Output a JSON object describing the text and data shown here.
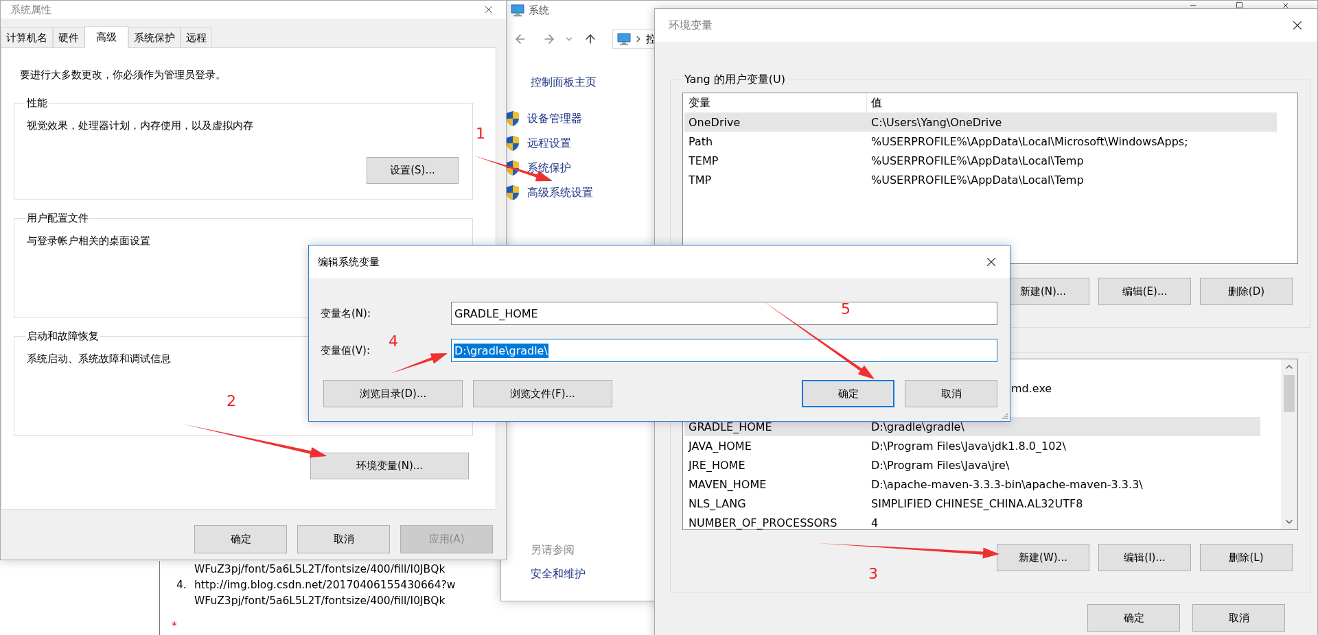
{
  "system_properties": {
    "title": "系统属性",
    "tabs": [
      {
        "label": "计算机名",
        "selected": false
      },
      {
        "label": "硬件",
        "selected": false
      },
      {
        "label": "高级",
        "selected": true
      },
      {
        "label": "系统保护",
        "selected": false
      },
      {
        "label": "远程",
        "selected": false
      }
    ],
    "notice": "要进行大多数更改，你必须作为管理员登录。",
    "groups": [
      {
        "title": "性能",
        "description": "视觉效果，处理器计划，内存使用，以及虚拟内存",
        "button": "设置(S)..."
      },
      {
        "title": "用户配置文件",
        "description": "与登录帐户相关的桌面设置"
      },
      {
        "title": "启动和故障恢复",
        "description": "系统启动、系统故障和调试信息"
      }
    ],
    "env_button": "环境变量(N)...",
    "buttons": [
      {
        "label": "确定",
        "disabled": false
      },
      {
        "label": "取消",
        "disabled": false
      },
      {
        "label": "应用(A)",
        "disabled": true
      }
    ]
  },
  "control_panel": {
    "title": "系统",
    "address": "控",
    "home_link": "控制面板主页",
    "links": [
      "设备管理器",
      "远程设置",
      "系统保护",
      "高级系统设置"
    ],
    "see_also": {
      "heading": "另请参阅",
      "links": [
        "安全和维护"
      ]
    }
  },
  "blog_page": {
    "lines": [
      {
        "text": "WFuZ3pj/font/5a6L5L2T/fontsize/400/fill/I0JBQk"
      },
      {
        "number": "4.",
        "text": "http://img.blog.csdn.net/20170406155430664?w"
      },
      {
        "text": "WFuZ3pj/font/5a6L5L2T/fontsize/400/fill/I0JBQk"
      }
    ],
    "required_mark": "*"
  },
  "environment_variables": {
    "title": "环境变量",
    "user_variables": {
      "title": "Yang 的用户变量(U)",
      "columns": [
        "变量",
        "值"
      ],
      "rows": [
        {
          "name": "OneDrive",
          "value": "C:\\Users\\Yang\\OneDrive",
          "selected": true
        },
        {
          "name": "Path",
          "value": "%USERPROFILE%\\AppData\\Local\\Microsoft\\WindowsApps;",
          "selected": false
        },
        {
          "name": "TEMP",
          "value": "%USERPROFILE%\\AppData\\Local\\Temp",
          "selected": false
        },
        {
          "name": "TMP",
          "value": "%USERPROFILE%\\AppData\\Local\\Temp",
          "selected": false
        }
      ],
      "buttons": [
        "新建(N)...",
        "编辑(E)...",
        "删除(D)"
      ]
    },
    "system_variables": {
      "rows": [
        {
          "value": "md.exe",
          "selected": false
        },
        {
          "name": "GRADLE_HOME",
          "value": "D:\\gradle\\gradle\\",
          "selected": true
        },
        {
          "name": "JAVA_HOME",
          "value": "D:\\Program Files\\Java\\jdk1.8.0_102\\",
          "selected": false
        },
        {
          "name": "JRE_HOME",
          "value": "D:\\Program Files\\Java\\jre\\",
          "selected": false
        },
        {
          "name": "MAVEN_HOME",
          "value": "D:\\apache-maven-3.3.3-bin\\apache-maven-3.3.3\\",
          "selected": false
        },
        {
          "name": "NLS_LANG",
          "value": "SIMPLIFIED CHINESE_CHINA.AL32UTF8",
          "selected": false
        },
        {
          "name": "NUMBER_OF_PROCESSORS",
          "value": "4",
          "selected": false
        }
      ],
      "buttons": [
        "新建(W)...",
        "编辑(I)...",
        "删除(L)"
      ]
    },
    "buttons": [
      "确定",
      "取消"
    ]
  },
  "edit_dialog": {
    "title": "编辑系统变量",
    "fields": [
      {
        "label": "变量名(N):",
        "value": "GRADLE_HOME",
        "selected": false
      },
      {
        "label": "变量值(V):",
        "value": "D:\\gradle\\gradle\\",
        "selected": true
      }
    ],
    "buttons": [
      {
        "label": "浏览目录(D)...",
        "default": false
      },
      {
        "label": "浏览文件(F)...",
        "default": false
      },
      {
        "label": "确定",
        "default": true
      },
      {
        "label": "取消",
        "default": false
      }
    ]
  },
  "annotations": [
    {
      "number": "1"
    },
    {
      "number": "2"
    },
    {
      "number": "3"
    },
    {
      "number": "4"
    },
    {
      "number": "5"
    }
  ]
}
